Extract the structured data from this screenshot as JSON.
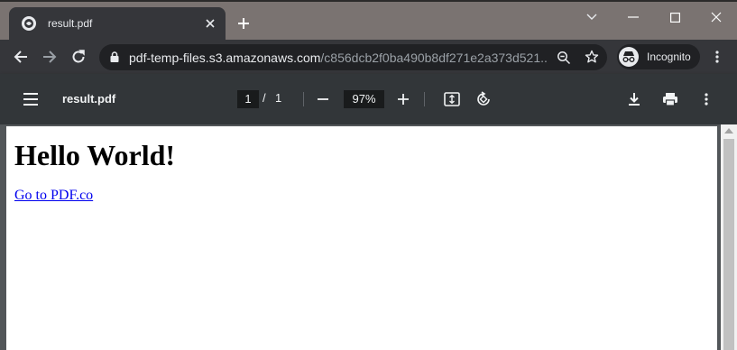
{
  "tab": {
    "title": "result.pdf"
  },
  "omnibox": {
    "url_host": "pdf-temp-files.s3.amazonaws.com",
    "url_path": "/c856dcb2f0ba490b8df271e2a373d521..."
  },
  "profile": {
    "label": "Incognito"
  },
  "pdf_toolbar": {
    "title": "result.pdf",
    "page_current": "1",
    "page_separator": "/",
    "page_total": "1",
    "zoom": "97%"
  },
  "document": {
    "heading": "Hello World!",
    "link_text": "Go to PDF.co"
  },
  "icons": {
    "tab_favicon": "globe-icon",
    "tab_close": "close-icon",
    "new_tab": "plus-icon",
    "back": "arrow-left-icon",
    "forward": "arrow-right-icon",
    "reload": "reload-icon",
    "lock": "lock-icon",
    "zoom": "magnifier-minus-icon",
    "bookmark": "star-icon",
    "incognito": "incognito-icon",
    "browser_menu": "kebab-icon",
    "pdf_menu": "hamburger-icon",
    "zoom_out": "minus-icon",
    "zoom_in": "plus-icon",
    "fit_page": "fit-to-page-icon",
    "rotate": "rotate-icon",
    "download": "download-icon",
    "print": "print-icon",
    "pdf_more": "kebab-icon"
  },
  "colors": {
    "tabstrip": "#7a7371",
    "toolbar": "#35363a",
    "pdf_toolbar": "#323639",
    "viewer_bg": "#525659",
    "link": "#0000ee"
  }
}
